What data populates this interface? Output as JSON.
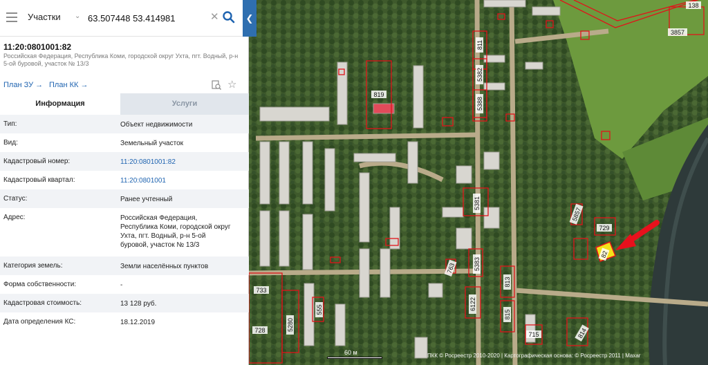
{
  "search": {
    "layer": "Участки",
    "query": "63.507448 53.414981"
  },
  "object": {
    "cadastral_number": "11:20:0801001:82",
    "address_line": "Российская Федерация, Республика Коми, городской округ Ухта, пгт. Водный, р-н 5-ой буровой, участок № 13/3"
  },
  "actions": {
    "plan_zu": "План ЗУ →",
    "plan_kk": "План КК →"
  },
  "tabs": {
    "info": "Информация",
    "services": "Услуги"
  },
  "info": [
    {
      "label": "Тип:",
      "value": "Объект недвижимости"
    },
    {
      "label": "Вид:",
      "value": "Земельный участок"
    },
    {
      "label": "Кадастровый номер:",
      "value": "11:20:0801001:82"
    },
    {
      "label": "Кадастровый квартал:",
      "value": "11:20:0801001"
    },
    {
      "label": "Статус:",
      "value": "Ранее учтенный"
    },
    {
      "label": "Адрес:",
      "value": "Российская Федерация, Республика Коми, городской округ Ухта, пгт. Водный, р-н 5-ой буровой, участок № 13/3"
    },
    {
      "label": "Категория земель:",
      "value": "Земли населённых пунктов"
    },
    {
      "label": "Форма собственности:",
      "value": "-"
    },
    {
      "label": "Кадастровая стоимость:",
      "value": "13 128 руб."
    },
    {
      "label": "Дата определения КС:",
      "value": "18.12.2019"
    }
  ],
  "map": {
    "scale": "60 м",
    "copyright": "ПКК © Росреестр 2010-2020 | Картографическая основа: © Росреестр 2011 | Maxar",
    "plot_labels": [
      "138",
      "3857",
      "811",
      "5382",
      "5388",
      "819",
      "5381",
      "5857",
      "729",
      "82",
      "763",
      "5383",
      "813",
      "815",
      "6122",
      "733",
      "728",
      "555",
      "5280",
      "715",
      "814"
    ],
    "highlight_color": "#f5e21a",
    "boundary_color": "#e0141a"
  }
}
